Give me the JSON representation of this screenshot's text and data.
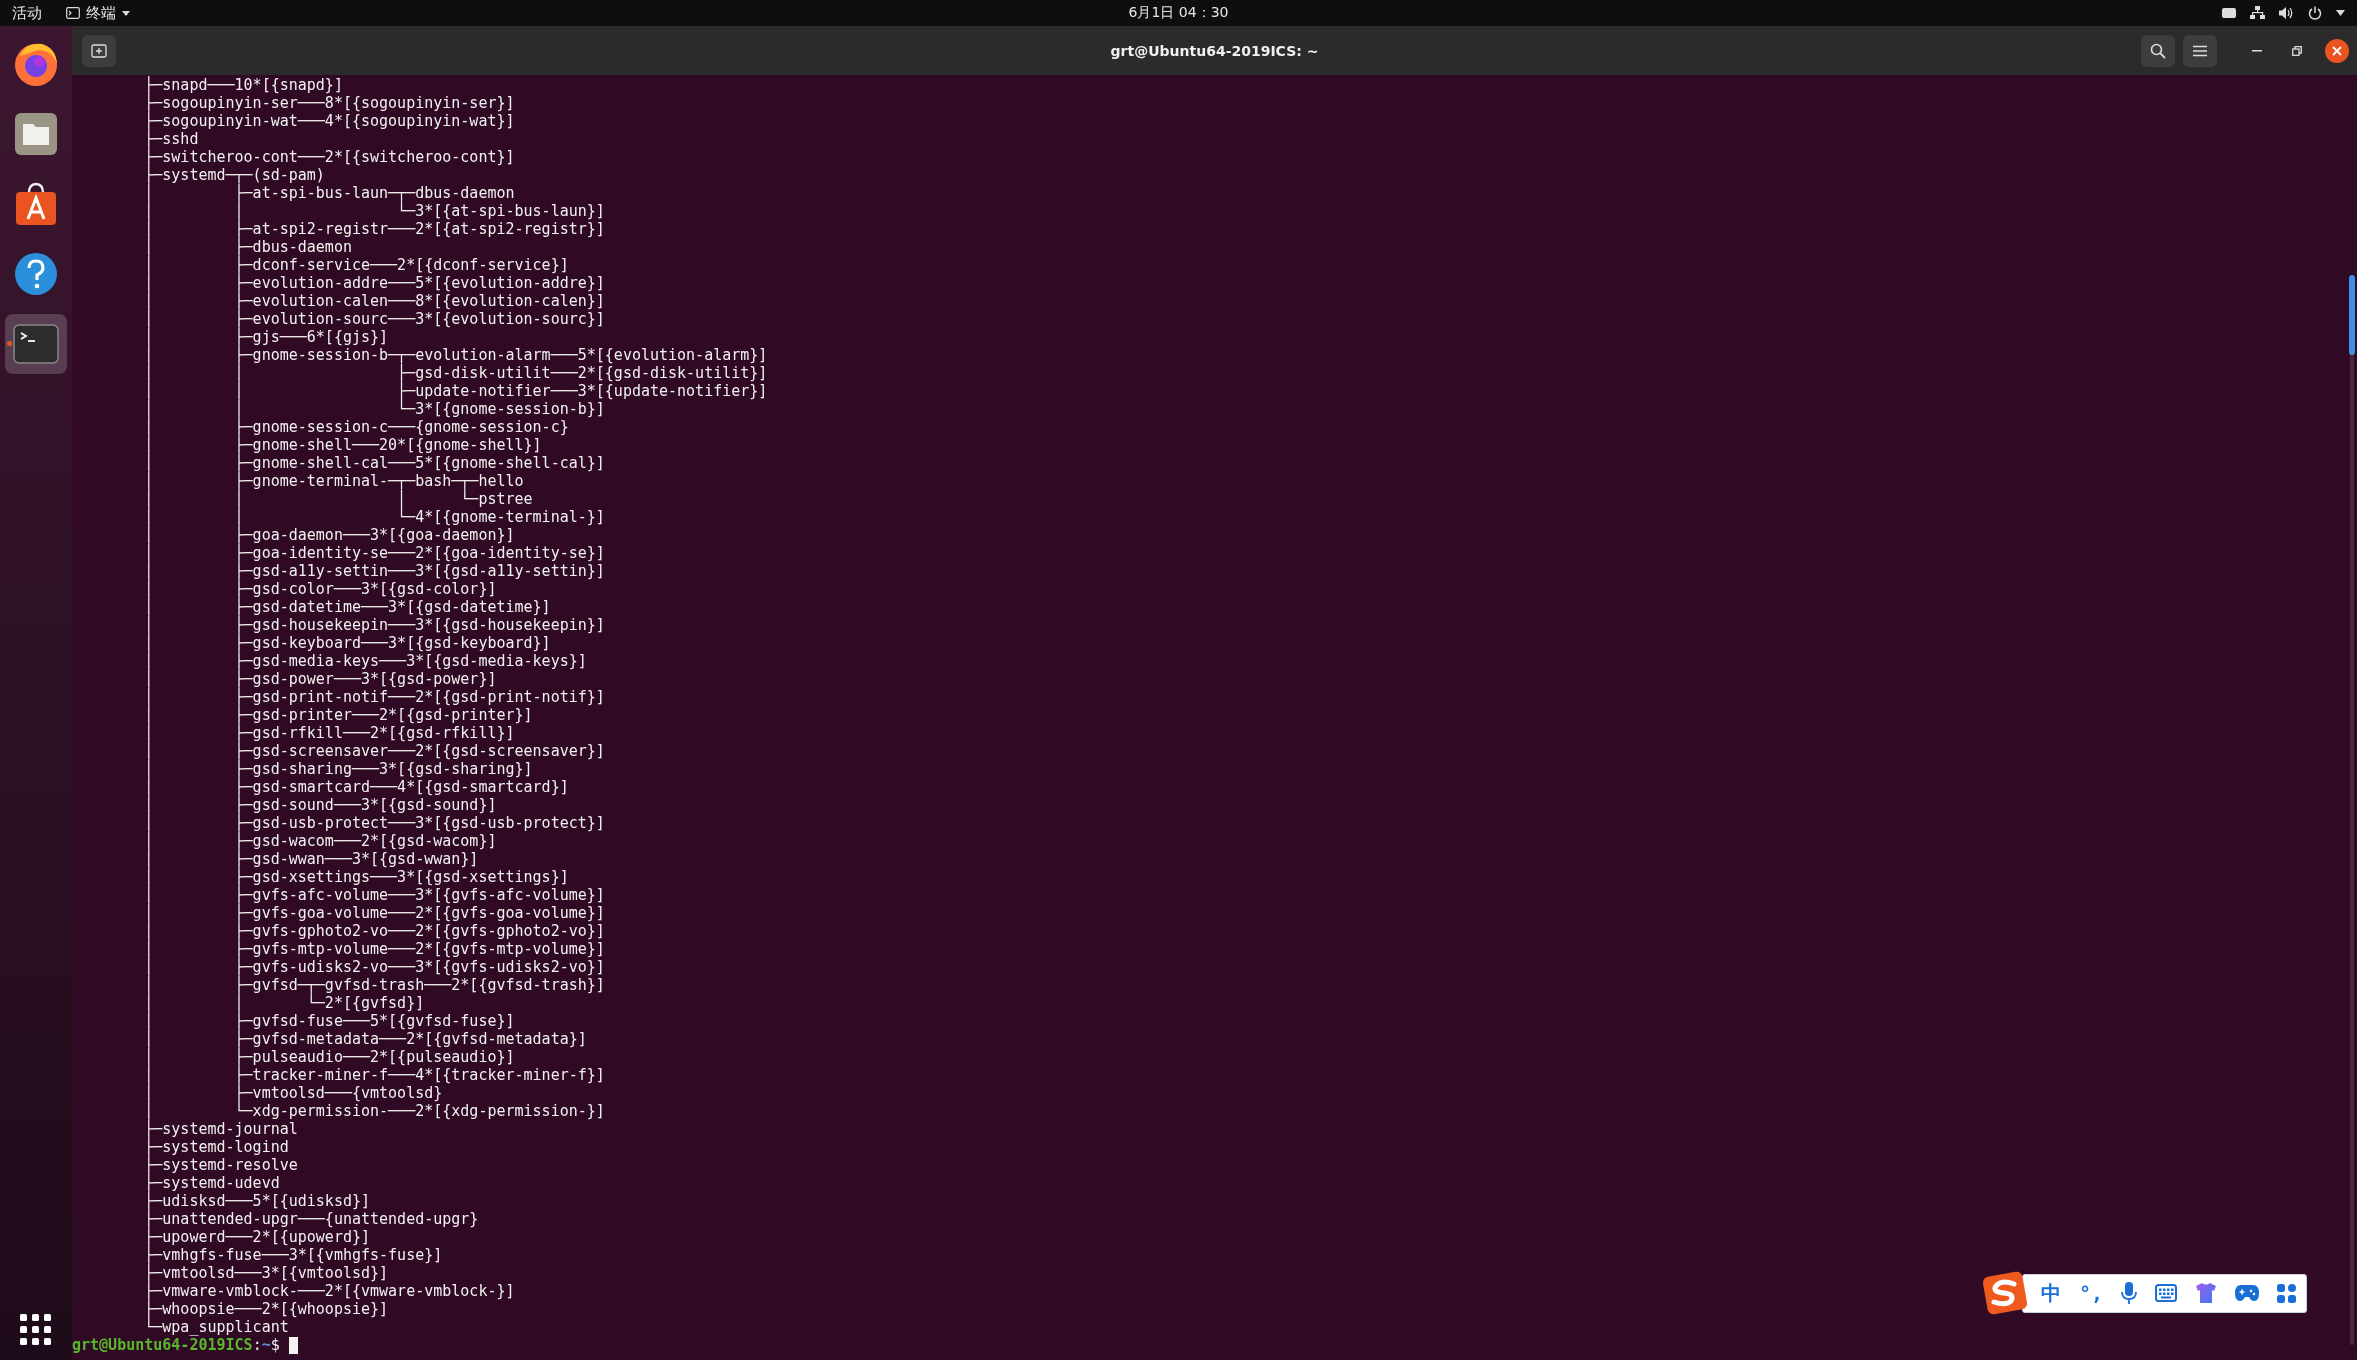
{
  "top_bar": {
    "activities": "活动",
    "app_menu": "终端",
    "clock": "6月1日 04：30"
  },
  "dock": {
    "items": [
      {
        "kind": "browser",
        "selected": false
      },
      {
        "kind": "files",
        "selected": false
      },
      {
        "kind": "store",
        "selected": false
      },
      {
        "kind": "help",
        "selected": false
      },
      {
        "kind": "terminal",
        "selected": true
      }
    ]
  },
  "window": {
    "title": "grt@Ubuntu64-2019ICS: ~"
  },
  "terminal": {
    "lines": [
      "        ├─snapd───10*[{snapd}]",
      "        ├─sogoupinyin-ser───8*[{sogoupinyin-ser}]",
      "        ├─sogoupinyin-wat───4*[{sogoupinyin-wat}]",
      "        ├─sshd",
      "        ├─switcheroo-cont───2*[{switcheroo-cont}]",
      "        ├─systemd─┬─(sd-pam)",
      "        │         ├─at-spi-bus-laun─┬─dbus-daemon",
      "        │         │                 └─3*[{at-spi-bus-laun}]",
      "        │         ├─at-spi2-registr───2*[{at-spi2-registr}]",
      "        │         ├─dbus-daemon",
      "        │         ├─dconf-service───2*[{dconf-service}]",
      "        │         ├─evolution-addre───5*[{evolution-addre}]",
      "        │         ├─evolution-calen───8*[{evolution-calen}]",
      "        │         ├─evolution-sourc───3*[{evolution-sourc}]",
      "        │         ├─gjs───6*[{gjs}]",
      "        │         ├─gnome-session-b─┬─evolution-alarm───5*[{evolution-alarm}]",
      "        │         │                 ├─gsd-disk-utilit───2*[{gsd-disk-utilit}]",
      "        │         │                 ├─update-notifier───3*[{update-notifier}]",
      "        │         │                 └─3*[{gnome-session-b}]",
      "        │         ├─gnome-session-c───{gnome-session-c}",
      "        │         ├─gnome-shell───20*[{gnome-shell}]",
      "        │         ├─gnome-shell-cal───5*[{gnome-shell-cal}]",
      "        │         ├─gnome-terminal-─┬─bash─┬─hello",
      "        │         │                 │      └─pstree",
      "        │         │                 └─4*[{gnome-terminal-}]",
      "        │         ├─goa-daemon───3*[{goa-daemon}]",
      "        │         ├─goa-identity-se───2*[{goa-identity-se}]",
      "        │         ├─gsd-a11y-settin───3*[{gsd-a11y-settin}]",
      "        │         ├─gsd-color───3*[{gsd-color}]",
      "        │         ├─gsd-datetime───3*[{gsd-datetime}]",
      "        │         ├─gsd-housekeepin───3*[{gsd-housekeepin}]",
      "        │         ├─gsd-keyboard───3*[{gsd-keyboard}]",
      "        │         ├─gsd-media-keys───3*[{gsd-media-keys}]",
      "        │         ├─gsd-power───3*[{gsd-power}]",
      "        │         ├─gsd-print-notif───2*[{gsd-print-notif}]",
      "        │         ├─gsd-printer───2*[{gsd-printer}]",
      "        │         ├─gsd-rfkill───2*[{gsd-rfkill}]",
      "        │         ├─gsd-screensaver───2*[{gsd-screensaver}]",
      "        │         ├─gsd-sharing───3*[{gsd-sharing}]",
      "        │         ├─gsd-smartcard───4*[{gsd-smartcard}]",
      "        │         ├─gsd-sound───3*[{gsd-sound}]",
      "        │         ├─gsd-usb-protect───3*[{gsd-usb-protect}]",
      "        │         ├─gsd-wacom───2*[{gsd-wacom}]",
      "        │         ├─gsd-wwan───3*[{gsd-wwan}]",
      "        │         ├─gsd-xsettings───3*[{gsd-xsettings}]",
      "        │         ├─gvfs-afc-volume───3*[{gvfs-afc-volume}]",
      "        │         ├─gvfs-goa-volume───2*[{gvfs-goa-volume}]",
      "        │         ├─gvfs-gphoto2-vo───2*[{gvfs-gphoto2-vo}]",
      "        │         ├─gvfs-mtp-volume───2*[{gvfs-mtp-volume}]",
      "        │         ├─gvfs-udisks2-vo───3*[{gvfs-udisks2-vo}]",
      "        │         ├─gvfsd─┬─gvfsd-trash───2*[{gvfsd-trash}]",
      "        │         │       └─2*[{gvfsd}]",
      "        │         ├─gvfsd-fuse───5*[{gvfsd-fuse}]",
      "        │         ├─gvfsd-metadata───2*[{gvfsd-metadata}]",
      "        │         ├─pulseaudio───2*[{pulseaudio}]",
      "        │         ├─tracker-miner-f───4*[{tracker-miner-f}]",
      "        │         ├─vmtoolsd───{vmtoolsd}",
      "        │         └─xdg-permission-───2*[{xdg-permission-}]",
      "        ├─systemd-journal",
      "        ├─systemd-logind",
      "        ├─systemd-resolve",
      "        ├─systemd-udevd",
      "        ├─udisksd───5*[{udisksd}]",
      "        ├─unattended-upgr───{unattended-upgr}",
      "        ├─upowerd───2*[{upowerd}]",
      "        ├─vmhgfs-fuse───3*[{vmhgfs-fuse}]",
      "        ├─vmtoolsd───3*[{vmtoolsd}]",
      "        ├─vmware-vmblock-───2*[{vmware-vmblock-}]",
      "        ├─whoopsie───2*[{whoopsie}]",
      "        └─wpa_supplicant"
    ],
    "prompt": {
      "user_host": "grt@Ubuntu64-2019ICS",
      "separator": ":",
      "path": "~",
      "symbol": "$"
    }
  },
  "input_method_bar": {
    "mode": "中",
    "punctuation": "°,"
  }
}
